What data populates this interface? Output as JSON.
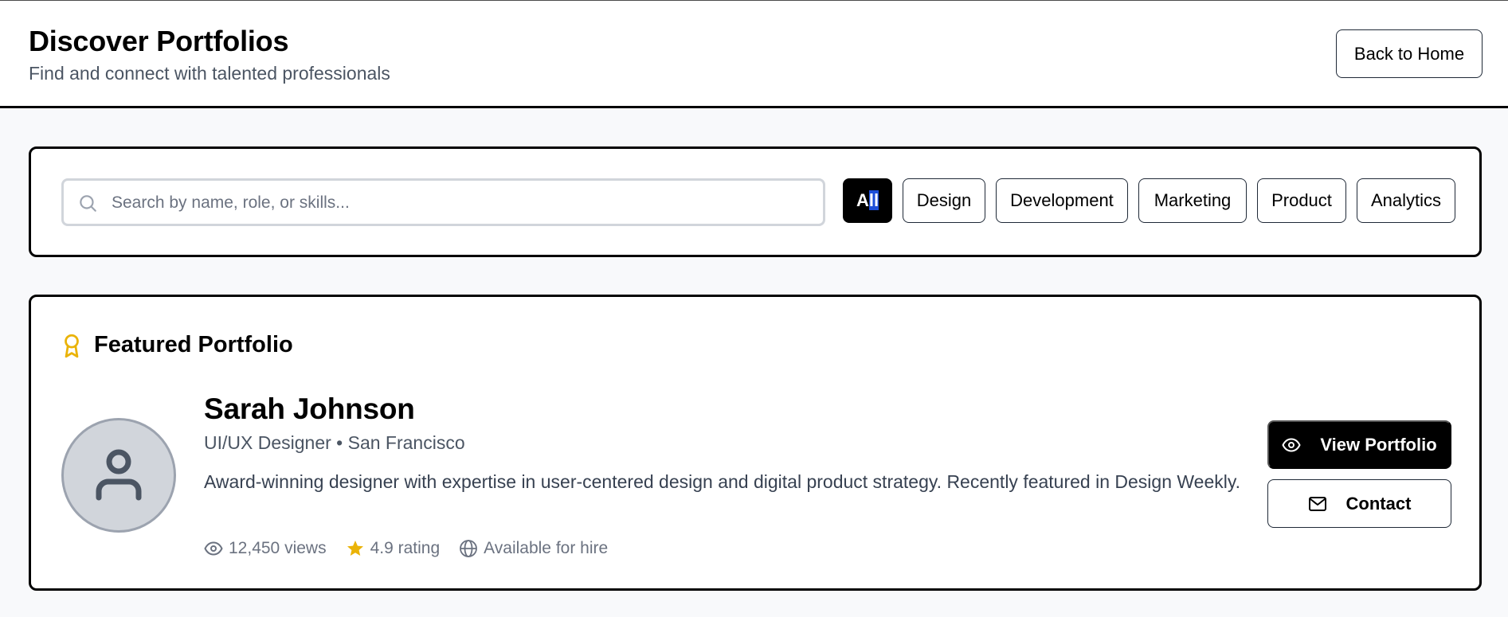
{
  "header": {
    "title": "Discover Portfolios",
    "subtitle": "Find and connect with talented professionals",
    "back_label": "Back to Home"
  },
  "search": {
    "placeholder": "Search by name, role, or skills..."
  },
  "filters": {
    "selected": "All",
    "items": [
      {
        "label": "All",
        "active": true
      },
      {
        "label": "Design",
        "active": false
      },
      {
        "label": "Development",
        "active": false
      },
      {
        "label": "Marketing",
        "active": false
      },
      {
        "label": "Product",
        "active": false
      },
      {
        "label": "Analytics",
        "active": false
      }
    ]
  },
  "featured": {
    "heading": "Featured Portfolio",
    "heading_icon": "award-icon",
    "name": "Sarah Johnson",
    "role": "UI/UX Designer • San Francisco",
    "bio": "Award-winning designer with expertise in user-centered design and digital product strategy. Recently featured in Design Weekly.",
    "stats": {
      "views": "12,450 views",
      "rating": "4.9 rating",
      "availability": "Available for hire"
    },
    "view_label": "View Portfolio",
    "contact_label": "Contact"
  },
  "colors": {
    "accent": "#000000",
    "star": "#eab308",
    "award": "#eab308",
    "page_bg": "#f8f9fb",
    "muted_text": "#6b7280"
  }
}
